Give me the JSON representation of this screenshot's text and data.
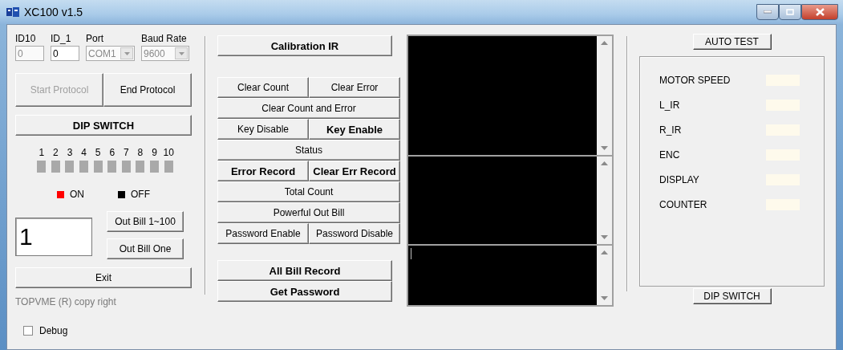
{
  "window": {
    "title": "XC100 v1.5"
  },
  "connection": [
    {
      "kind": "text",
      "label": "ID10",
      "value": "0",
      "disabled": true
    },
    {
      "kind": "text",
      "label": "ID_1",
      "value": "0",
      "disabled": false
    },
    {
      "kind": "select",
      "label": "Port",
      "value": "COM1",
      "disabled": true
    },
    {
      "kind": "select",
      "label": "Baud Rate",
      "value": "9600",
      "disabled": true
    }
  ],
  "protocol_buttons": [
    {
      "label": "Start Protocol",
      "disabled": true
    },
    {
      "label": "End Protocol",
      "disabled": false
    }
  ],
  "dip_switch": {
    "title": "DIP SWITCH",
    "switches": [
      {
        "label": "1",
        "on": false
      },
      {
        "label": "2",
        "on": false
      },
      {
        "label": "3",
        "on": false
      },
      {
        "label": "4",
        "on": false
      },
      {
        "label": "5",
        "on": false
      },
      {
        "label": "6",
        "on": false
      },
      {
        "label": "7",
        "on": false
      },
      {
        "label": "8",
        "on": false
      },
      {
        "label": "9",
        "on": false
      },
      {
        "label": "10",
        "on": false
      }
    ]
  },
  "legend": [
    {
      "label": "ON",
      "color": "#ff0000"
    },
    {
      "label": "OFF",
      "color": "#000000"
    }
  ],
  "bill": {
    "value": "1",
    "buttons": [
      "Out Bill 1~100",
      "Out Bill One"
    ]
  },
  "exit_button": "Exit",
  "copyright": "TOPVME (R) copy right",
  "debug": {
    "label": "Debug",
    "checked": false
  },
  "calibration_button": "Calibration IR",
  "command_rows": [
    [
      {
        "label": "Clear Count",
        "bold": false
      },
      {
        "label": "Clear Error",
        "bold": false
      }
    ],
    [
      {
        "label": "Clear Count and Error",
        "bold": false
      }
    ],
    [
      {
        "label": "Key Disable",
        "bold": false
      },
      {
        "label": "Key Enable",
        "bold": true
      }
    ],
    [
      {
        "label": "Status",
        "bold": false
      }
    ],
    [
      {
        "label": "Error Record",
        "bold": true
      },
      {
        "label": "Clear Err Record",
        "bold": true
      }
    ],
    [
      {
        "label": "Total Count",
        "bold": false
      }
    ],
    [
      {
        "label": "Powerful Out Bill",
        "bold": false
      }
    ],
    [
      {
        "label": "Password  Enable",
        "bold": false
      },
      {
        "label": "Password  Disable",
        "bold": false
      }
    ]
  ],
  "record_buttons": [
    "All Bill Record",
    "Get Password"
  ],
  "consoles": [
    {
      "focused": false
    },
    {
      "focused": false
    },
    {
      "focused": true
    }
  ],
  "auto_test_button": "AUTO TEST",
  "tests": [
    "MOTOR SPEED",
    "L_IR",
    "R_IR",
    "ENC",
    "DISPLAY",
    "COUNTER"
  ],
  "dip_switch_button": "DIP SWITCH"
}
